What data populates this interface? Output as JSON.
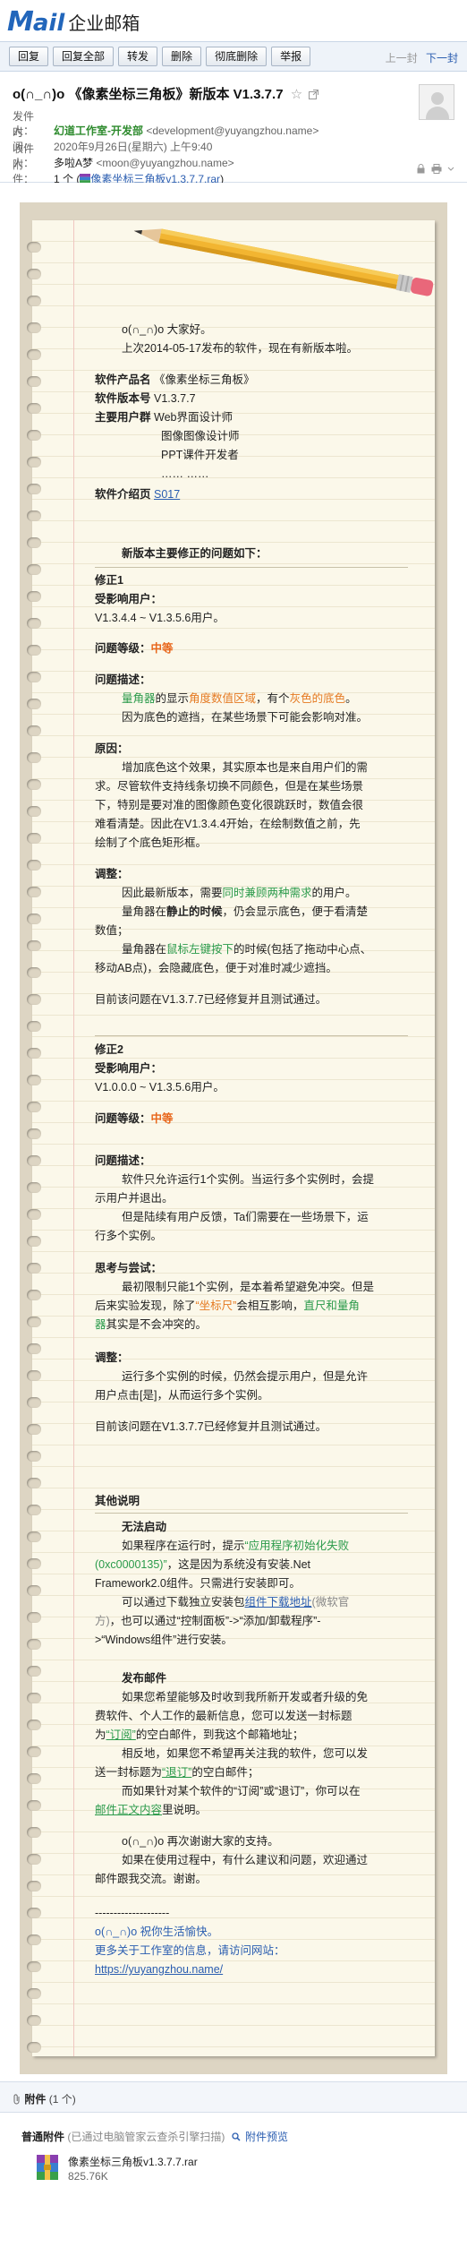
{
  "app": {
    "logo_m": "M",
    "logo_ail": "ail",
    "logo_zh": "企业邮箱"
  },
  "toolbar": {
    "buttons": [
      "回复",
      "回复全部",
      "转发",
      "删除",
      "彻底删除",
      "举报"
    ],
    "prev": "上一封",
    "next": "下一封"
  },
  "header": {
    "subject": "o(∩_∩)o 《像素坐标三角板》新版本 V1.3.7.7",
    "star": "☆",
    "from_label": "发件人：",
    "from_name": "幻道工作室-开发部",
    "from_addr": "<development@yuyangzhou.name>",
    "time_label": "时　间：",
    "time": "2020年9月26日(星期六) 上午9:40",
    "to_label": "收件人：",
    "to_name": "多啦A梦",
    "to_addr": "<moon@yuyangzhou.name>",
    "attach_label": "附　件：",
    "attach_count": "1 个",
    "attach_name": "像素坐标三角板v1.3.7.7.rar"
  },
  "body": {
    "greet": "o(∩_∩)o  大家好。",
    "intro": "上次2014-05-17发布的软件，现在有新版本啦。",
    "product_label": "软件产品名",
    "product": "《像素坐标三角板》",
    "version_label": "软件版本号",
    "version": "V1.3.7.7",
    "users_label": "主要用户群",
    "users": [
      "Web界面设计师",
      "图像图像设计师",
      "PPT课件开发者",
      "……  ……"
    ],
    "home_label": "软件介绍页",
    "home": "S017",
    "section_title": "新版本主要修正的问题如下：",
    "fix1": {
      "title": "修正1",
      "affected_label": "受影响用户：",
      "affected": "V1.3.4.4 ~ V1.3.5.6用户。",
      "level_label": "问题等级：",
      "level": "中等",
      "desc_label": "问题描述：",
      "desc1_a": "量角器",
      "desc1_b": "的显示",
      "desc1_c": "角度数值区域",
      "desc1_d": "，有个",
      "desc1_e": "灰色的底色",
      "desc1_f": "。",
      "desc2": "因为底色的遮挡，在某些场景下可能会影响对准。",
      "cause_label": "原因：",
      "cause": [
        "增加底色这个效果，其实原本也是来自用户们的需",
        "求。尽管软件支持线条切换不同颜色，但是在某些场景",
        "下，特别是要对准的图像颜色变化很跳跃时，数值会很",
        "难看清楚。因此在V1.3.4.4开始，在绘制数值之前，先",
        "绘制了个底色矩形框。"
      ],
      "adjust_label": "调整：",
      "adjust1_a": "因此最新版本，需要",
      "adjust1_b": "同时兼顾两种需求",
      "adjust1_c": "的用户。",
      "adjust2_a": "量角器在",
      "adjust2_b": "静止的时候",
      "adjust2_c": "，仍会显示底色，便于看清楚",
      "adjust2_d": "数值；",
      "adjust3_a": "量角器在",
      "adjust3_b": "鼠标左键按下",
      "adjust3_c": "的时候(包括了拖动中心点、",
      "adjust3_d": "移动AB点)，会隐藏底色，便于对准时减少遮挡。",
      "done": "目前该问题在V1.3.7.7已经修复并且测试通过。"
    },
    "fix2": {
      "title": "修正2",
      "affected_label": "受影响用户：",
      "affected": "V1.0.0.0 ~ V1.3.5.6用户。",
      "level_label": "问题等级：",
      "level": "中等",
      "desc_label": "问题描述：",
      "desc": [
        "软件只允许运行1个实例。当运行多个实例时，会提",
        "示用户并退出。",
        "但是陆续有用户反馈，Ta们需要在一些场景下，运",
        "行多个实例。"
      ],
      "think_label": "思考与尝试：",
      "think1": "最初限制只能1个实例，是本着希望避免冲突。但是",
      "think2_a": "后来实验发现，除了",
      "think2_b": "“坐标尺”",
      "think2_c": "会相互影响，",
      "think2_d": "直尺和量角",
      "think3_a": "器",
      "think3_b": "其实是不会冲突的。",
      "adjust_label": "调整：",
      "adjust": [
        "运行多个实例的时候，仍然会提示用户，但是允许",
        "用户点击[是]，从而运行多个实例。"
      ],
      "done": "目前该问题在V1.3.7.7已经修复并且测试通过。"
    },
    "other_title": "其他说明",
    "launch_title": "无法启动",
    "launch1_a": "如果程序在运行时，提示",
    "launch1_b": "“应用程序初始化失败",
    "launch2_a": "(0xc0000135)”",
    "launch2_b": "，这是因为系统没有安装.Net",
    "launch3": "Framework2.0组件。只需进行安装即可。",
    "launch4_a": "可以通过下载独立安装包",
    "launch4_b": "组件下载地址",
    "launch4_c": "(微软官",
    "launch5_a": "方)",
    "launch5_b": "，也可以通过“控制面板”->“添加/卸载程序”-",
    "launch6": ">“Windows组件”进行安装。",
    "mail_title": "发布邮件",
    "mail": [
      "如果您希望能够及时收到我所新开发或者升级的免",
      "费软件、个人工作的最新信息，您可以发送一封标题",
      "为“订阅”的空白邮件，到我这个邮箱地址；"
    ],
    "mail_r1_a": "为",
    "mail_r1_b": "“订阅”",
    "mail_r1_c": "的空白邮件，到我这个邮箱地址；",
    "mail4": "相反地，如果您不希望再关注我的软件，您可以发",
    "mail5_a": "送一封标题为",
    "mail5_b": "“退订”",
    "mail5_c": "的空白邮件；",
    "mail6": "而如果针对某个软件的“订阅”或“退订”，你可以在",
    "mail7_a": "邮件正文内容",
    "mail7_b": "里说明。",
    "thanks": "o(∩_∩)o 再次谢谢大家的支持。",
    "thanks2": "如果在使用过程中，有什么建议和问题，欢迎通过",
    "thanks3": "邮件跟我交流。谢谢。",
    "sig_sep": "--------------------",
    "sig1": "o(∩_∩)o  祝你生活愉快。",
    "sig2": "更多关于工作室的信息，请访问网站：",
    "sig3": "https://yuyangzhou.name/"
  },
  "attachments": {
    "title": "附件",
    "count": "(1 个)",
    "group": "普通附件",
    "group_note": "(已通过电脑管家云查杀引擎扫描)",
    "preview": "附件预览",
    "file_name": "像素坐标三角板v1.3.7.7.rar",
    "file_size": "825.76K"
  },
  "colors": {
    "accent": "#2a5db0",
    "green": "#2a9a4a",
    "orange": "#e8661b",
    "paper": "#fbf8ea"
  }
}
